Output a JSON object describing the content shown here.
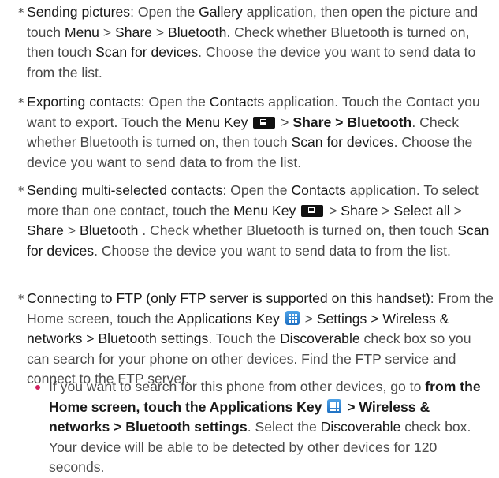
{
  "marks": {
    "star": "*"
  },
  "item1": {
    "title": "Sending pictures",
    "t1": ": Open the ",
    "gallery": "Gallery",
    "t2": " application, then open the picture and touch ",
    "menu": "Menu",
    "sep1": " > ",
    "share": "Share",
    "sep2": " > ",
    "bluetooth": "Bluetooth",
    "t3": ". Check whether Bluetooth is turned on, then touch ",
    "scan": "Scan for devices",
    "t4": ". Choose the device you want to send data to from the list."
  },
  "item2": {
    "title": "Exporting contacts:",
    "t1": " Open the ",
    "contacts": "Contacts",
    "t2": " application. Touch the Contact you want to export. Touch the ",
    "menukey": "Menu Key",
    "t3": " > ",
    "share_bt": "Share > Bluetooth",
    "t4": ". Check whether Bluetooth is turned on, then touch ",
    "scan": "Scan for devices",
    "t5": ". Choose the device you want to send data to from the list."
  },
  "item3": {
    "title": "Sending multi-selected contacts",
    "t1": ": Open the ",
    "contacts": "Contacts",
    "t2": " application. To select more than one contact, touch the ",
    "menukey": "Menu Key",
    "t3": " > ",
    "share1": "Share",
    "t4": " > ",
    "selectall": "Select all",
    "t5": " > ",
    "share2": "Share",
    "t6": " > ",
    "bluetooth": "Bluetooth",
    "t7": " . Check whether Bluetooth is turned on, then touch ",
    "scan": "Scan for devices",
    "t8": ". Choose the device you want to send data to from the list."
  },
  "item4": {
    "title": "Connecting to FTP (only FTP server is supported on this handset)",
    "t1": ": From the Home screen, touch the ",
    "appkey": "Applications Key",
    "t2": " > ",
    "path": "Settings > Wireless & networks > Bluetooth settings",
    "t3": ". Touch the ",
    "discoverable": "Discoverable",
    "t4": " check box so you can search for your phone on other devices. Find the FTP service and connect to the FTP server."
  },
  "sub1": {
    "t1": "If you want to search for this phone from other devices, go to ",
    "path1": "from the Home screen, touch the Applications Key",
    "t2": " ",
    "path2": "> Wireless & networks > Bluetooth settings",
    "t3": ". Select the ",
    "discoverable": "Discoverable",
    "t4": " check box. Your device will be able to be detected by other devices for 120 seconds."
  },
  "colors": {
    "text": "#4a4a4a",
    "keyword": "#1a1a1a",
    "bullet": "#d0205f",
    "app_key": "#2a86d9"
  },
  "icons": {
    "menu_key": "menu-key-icon",
    "applications_key": "applications-key-icon"
  }
}
